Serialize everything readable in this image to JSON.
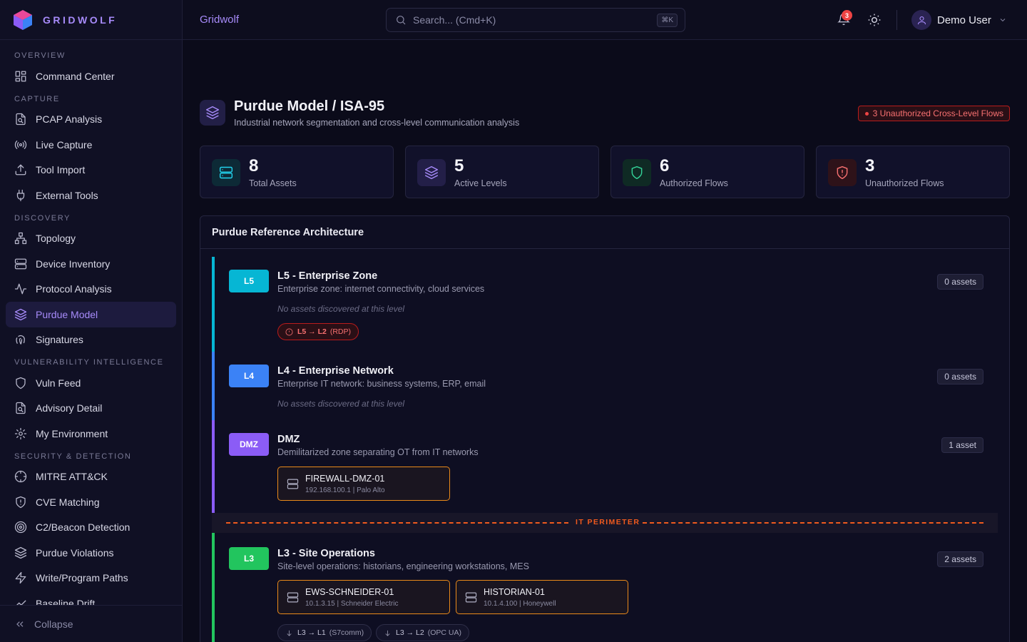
{
  "brand": {
    "name": "GRIDWOLF"
  },
  "topbar": {
    "title": "Gridwolf",
    "search_placeholder": "Search... (Cmd+K)",
    "search_kbd": "⌘K",
    "notification_count": "3",
    "user_name": "Demo User"
  },
  "sidebar": {
    "sections": [
      {
        "title": "OVERVIEW",
        "items": [
          {
            "label": "Command Center",
            "icon": "grid-icon"
          }
        ]
      },
      {
        "title": "CAPTURE",
        "items": [
          {
            "label": "PCAP Analysis",
            "icon": "file-search-icon"
          },
          {
            "label": "Live Capture",
            "icon": "radio-icon"
          },
          {
            "label": "Tool Import",
            "icon": "upload-icon"
          },
          {
            "label": "External Tools",
            "icon": "plug-icon"
          }
        ]
      },
      {
        "title": "DISCOVERY",
        "items": [
          {
            "label": "Topology",
            "icon": "network-icon"
          },
          {
            "label": "Device Inventory",
            "icon": "server-icon"
          },
          {
            "label": "Protocol Analysis",
            "icon": "activity-icon"
          },
          {
            "label": "Purdue Model",
            "icon": "layers-icon",
            "active": true
          },
          {
            "label": "Signatures",
            "icon": "fingerprint-icon"
          }
        ]
      },
      {
        "title": "VULNERABILITY INTELLIGENCE",
        "items": [
          {
            "label": "Vuln Feed",
            "icon": "shield-icon"
          },
          {
            "label": "Advisory Detail",
            "icon": "file-search-icon"
          },
          {
            "label": "My Environment",
            "icon": "gear-icon"
          }
        ]
      },
      {
        "title": "SECURITY & DETECTION",
        "items": [
          {
            "label": "MITRE ATT&CK",
            "icon": "crosshair-icon"
          },
          {
            "label": "CVE Matching",
            "icon": "shield-alert-icon"
          },
          {
            "label": "C2/Beacon Detection",
            "icon": "radar-icon"
          },
          {
            "label": "Purdue Violations",
            "icon": "layers-icon"
          },
          {
            "label": "Write/Program Paths",
            "icon": "zap-icon"
          },
          {
            "label": "Baseline Drift",
            "icon": "trend-icon"
          }
        ]
      }
    ],
    "collapse_label": "Collapse"
  },
  "page": {
    "title": "Purdue Model / ISA-95",
    "subtitle": "Industrial network segmentation and cross-level communication analysis",
    "alert": "3 Unauthorized Cross-Level Flows"
  },
  "stats": [
    {
      "value": "8",
      "label": "Total Assets",
      "icon": "server-icon",
      "color": "#22d3ee",
      "bg": "#0d2a36"
    },
    {
      "value": "5",
      "label": "Active Levels",
      "icon": "layers-icon",
      "color": "#a78bfa",
      "bg": "#231f48"
    },
    {
      "value": "6",
      "label": "Authorized Flows",
      "icon": "shield-icon",
      "color": "#34d399",
      "bg": "#0f2a24"
    },
    {
      "value": "3",
      "label": "Unauthorized Flows",
      "icon": "shield-alert-icon",
      "color": "#f87171",
      "bg": "#2e1219"
    }
  ],
  "architecture": {
    "title": "Purdue Reference Architecture",
    "perimeter_label": "IT PERIMETER",
    "levels": [
      {
        "tag": "L5",
        "color": "#06b6d4",
        "name": "L5 - Enterprise Zone",
        "description": "Enterprise zone: internet connectivity, cloud services",
        "asset_count": "0 assets",
        "empty": "No assets discovered at this level",
        "flows": [
          {
            "arrow": "L5 → L2",
            "protocol": "(RDP)",
            "authorized": false
          }
        ]
      },
      {
        "tag": "L4",
        "color": "#3b82f6",
        "name": "L4 - Enterprise Network",
        "description": "Enterprise IT network: business systems, ERP, email",
        "asset_count": "0 assets",
        "empty": "No assets discovered at this level"
      },
      {
        "tag": "DMZ",
        "color": "#8b5cf6",
        "name": "DMZ",
        "description": "Demilitarized zone separating OT from IT networks",
        "asset_count": "1 asset",
        "assets": [
          {
            "name": "FIREWALL-DMZ-01",
            "meta": "192.168.100.1 | Palo Alto"
          }
        ]
      },
      {
        "tag": "L3",
        "color": "#22c55e",
        "name": "L3 - Site Operations",
        "description": "Site-level operations: historians, engineering workstations, MES",
        "asset_count": "2 assets",
        "assets": [
          {
            "name": "EWS-SCHNEIDER-01",
            "meta": "10.1.3.15 | Schneider Electric"
          },
          {
            "name": "HISTORIAN-01",
            "meta": "10.1.4.100 | Honeywell"
          }
        ],
        "flows": [
          {
            "arrow": "L3 → L1",
            "protocol": "(S7comm)",
            "authorized": true
          },
          {
            "arrow": "L3 → L2",
            "protocol": "(OPC UA)",
            "authorized": true
          }
        ]
      }
    ]
  }
}
